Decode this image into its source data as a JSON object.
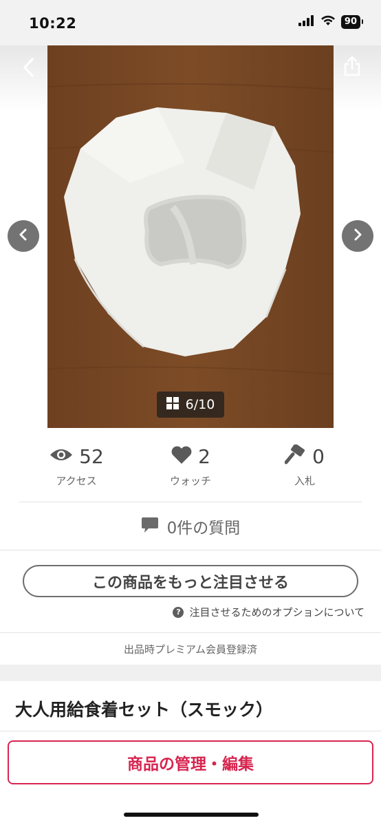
{
  "status_bar": {
    "time": "10:22",
    "battery": "90"
  },
  "gallery": {
    "counter": "6/10"
  },
  "stats": [
    {
      "icon": "eye-icon",
      "value": "52",
      "label": "アクセス"
    },
    {
      "icon": "heart-icon",
      "value": "2",
      "label": "ウォッチ"
    },
    {
      "icon": "gavel-icon",
      "value": "0",
      "label": "入札"
    }
  ],
  "questions": {
    "label": "0件の質問"
  },
  "promote": {
    "button_label": "この商品をもっと注目させる",
    "help_label": "注目させるためのオプションについて"
  },
  "premium_note": "出品時プレミアム会員登録済",
  "item": {
    "title": "大人用給食着セット（スモック）"
  },
  "manage_button": "商品の管理・編集",
  "colors": {
    "accent": "#d7244f",
    "photo_background": "#7a4a25"
  }
}
